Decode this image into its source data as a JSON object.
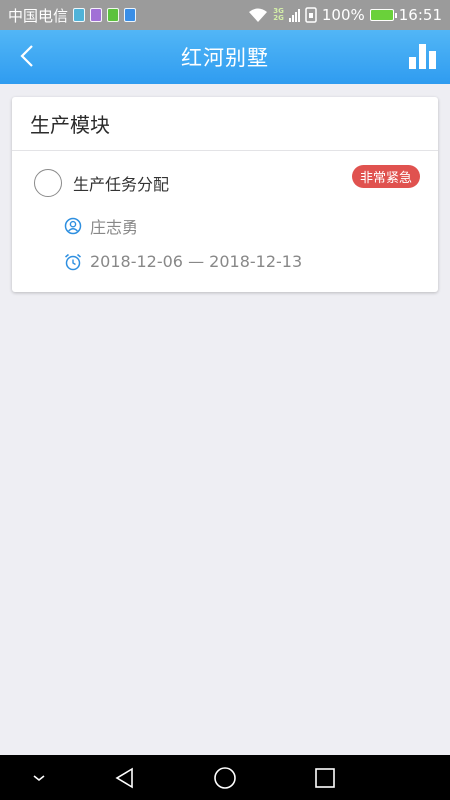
{
  "status_bar": {
    "carrier": "中国电信",
    "network_top": "3G",
    "network_bottom": "2G",
    "battery_percent": "100%",
    "time": "16:51",
    "app_icons": [
      "gallery-icon",
      "photo-icon",
      "wechat-icon",
      "sim-icon"
    ]
  },
  "header": {
    "title": "红河别墅",
    "color": "#3aa6f3"
  },
  "module": {
    "title": "生产模块",
    "tasks": [
      {
        "name": "生产任务分配",
        "priority": "非常紧急",
        "priority_color": "#e0524f",
        "assignee": "庄志勇",
        "date_range": "2018-12-06 — 2018-12-13",
        "checked": false
      }
    ]
  },
  "nav_bar": {
    "items": [
      "collapse-icon",
      "back-triangle-icon",
      "home-circle-icon",
      "recents-square-icon"
    ]
  }
}
